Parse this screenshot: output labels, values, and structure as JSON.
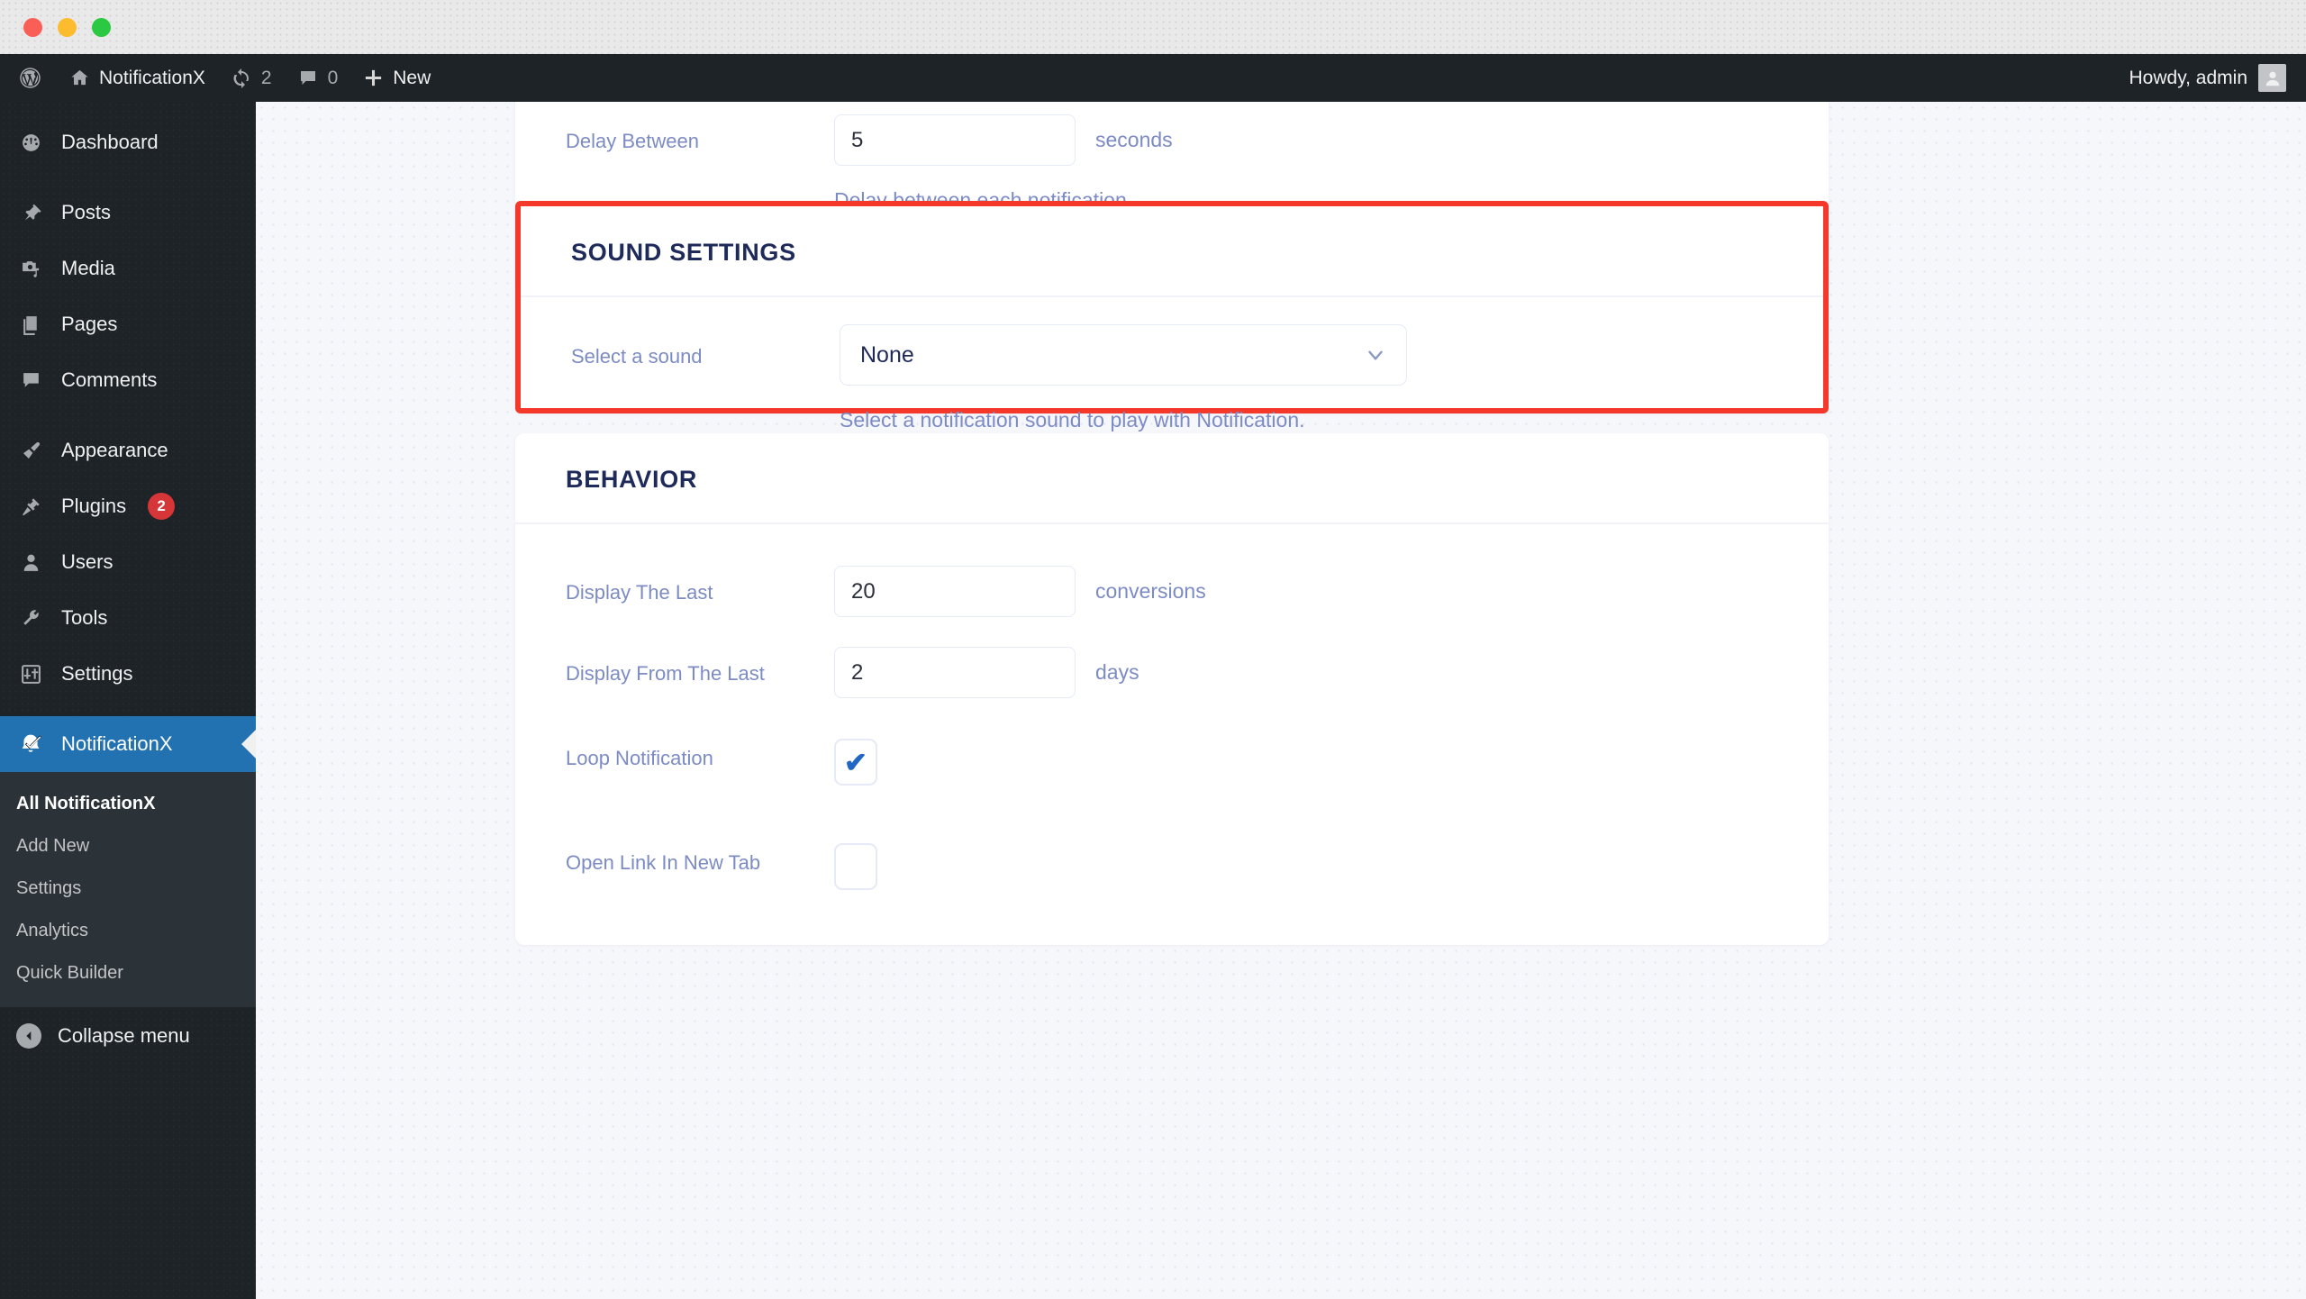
{
  "window": {
    "traffic_lights": [
      "close",
      "minimize",
      "maximize"
    ]
  },
  "adminbar": {
    "wp_logo": "wordpress-logo-icon",
    "site_name": "NotificationX",
    "site_icon": "home-icon",
    "updates_icon": "updates-icon",
    "updates_count": "2",
    "comments_icon": "comment-bubble-icon",
    "comments_count": "0",
    "new_icon": "plus-icon",
    "new_label": "New",
    "greeting": "Howdy, admin",
    "avatar": "user-avatar-icon"
  },
  "sidebar": {
    "items": [
      {
        "label": "Dashboard",
        "icon": "dashboard-gauge-icon"
      },
      {
        "label": "Posts",
        "icon": "pin-icon"
      },
      {
        "label": "Media",
        "icon": "media-camera-music-icon"
      },
      {
        "label": "Pages",
        "icon": "pages-document-icon"
      },
      {
        "label": "Comments",
        "icon": "comment-bubble-icon"
      },
      {
        "label": "Appearance",
        "icon": "paintbrush-icon"
      },
      {
        "label": "Plugins",
        "icon": "plug-icon",
        "badge": "2"
      },
      {
        "label": "Users",
        "icon": "user-icon"
      },
      {
        "label": "Tools",
        "icon": "wrench-icon"
      },
      {
        "label": "Settings",
        "icon": "sliders-icon"
      },
      {
        "label": "NotificationX",
        "icon": "notificationx-bell-icon",
        "active": true
      }
    ],
    "submenu": [
      {
        "label": "All NotificationX",
        "current": true
      },
      {
        "label": "Add New"
      },
      {
        "label": "Settings"
      },
      {
        "label": "Analytics"
      },
      {
        "label": "Quick Builder"
      }
    ],
    "collapse_label": "Collapse menu",
    "collapse_icon": "chevron-left-circle-icon",
    "active_color": "#2271b1",
    "badge_color": "#d63638"
  },
  "main": {
    "timing_card": {
      "delay_between": {
        "label": "Delay Between",
        "value": "5",
        "unit": "seconds",
        "help": "Delay between each notification"
      }
    },
    "sound_card": {
      "title": "Sound Settings",
      "highlight_color": "#f4392b",
      "select_a_sound": {
        "label": "Select a sound",
        "value": "None",
        "chevron": "chevron-down-icon",
        "help": "Select a notification sound to play with Notification.",
        "options": [
          "None"
        ]
      }
    },
    "behavior_card": {
      "title": "Behavior",
      "display_the_last": {
        "label": "Display The Last",
        "value": "20",
        "unit": "conversions"
      },
      "display_from_the_last": {
        "label": "Display From The Last",
        "value": "2",
        "unit": "days"
      },
      "loop_notification": {
        "label": "Loop Notification",
        "checked": true,
        "tick": "✔"
      },
      "open_link_in_new_tab": {
        "label": "Open Link In New Tab",
        "checked": false,
        "tick": ""
      }
    }
  }
}
